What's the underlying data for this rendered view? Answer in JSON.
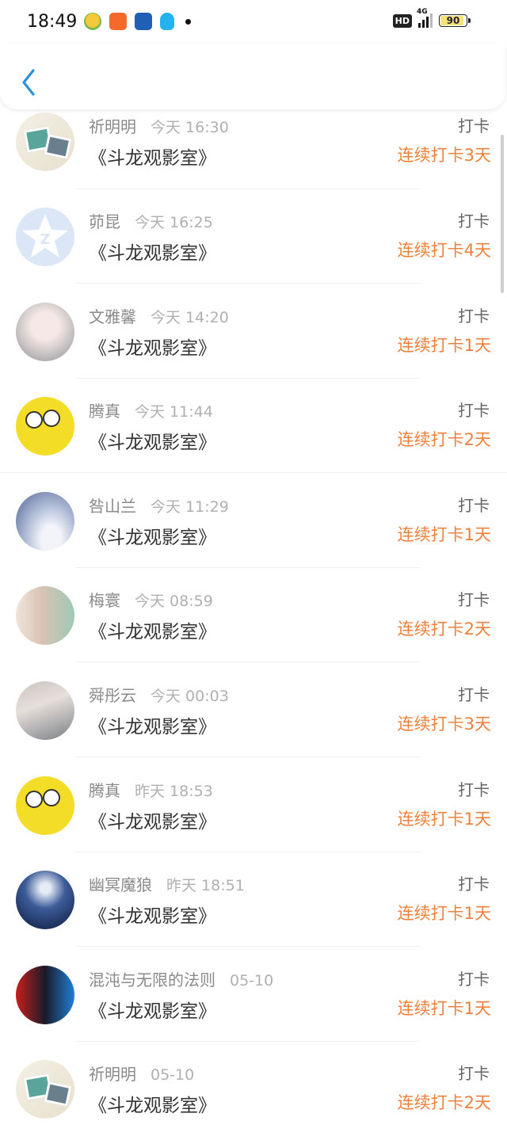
{
  "status_bar": {
    "time": "18:49",
    "hd_label": "HD",
    "network_label": "4G",
    "battery_percent": "90",
    "battery_level": 0.9,
    "notification_icons": [
      "emoji-app-icon",
      "orange-app-icon",
      "blue-app-icon",
      "qq-icon",
      "dot-icon"
    ]
  },
  "header": {
    "back_icon": "chevron-left-icon"
  },
  "colors": {
    "accent": "#f0813c",
    "back_arrow": "#2b8fe0"
  },
  "checkins": [
    {
      "name": "祈明明",
      "when": "今天 16:30",
      "room": "《斗龙观影室》",
      "action": "打卡",
      "streak": "连续打卡3天",
      "avatar": "photos"
    },
    {
      "name": "茆昆",
      "when": "今天 16:25",
      "room": "《斗龙观影室》",
      "action": "打卡",
      "streak": "连续打卡4天",
      "avatar": "qq"
    },
    {
      "name": "文雅馨",
      "when": "今天 14:20",
      "room": "《斗龙观影室》",
      "action": "打卡",
      "streak": "连续打卡1天",
      "avatar": "anime"
    },
    {
      "name": "腾真",
      "when": "今天 11:44",
      "room": "《斗龙观影室》",
      "action": "打卡",
      "streak": "连续打卡2天",
      "avatar": "sponge"
    },
    {
      "name": "咎山兰",
      "when": "今天 11:29",
      "room": "《斗龙观影室》",
      "action": "打卡",
      "streak": "连续打卡1天",
      "avatar": "sky"
    },
    {
      "name": "梅寰",
      "when": "今天 08:59",
      "room": "《斗龙观影室》",
      "action": "打卡",
      "streak": "连续打卡2天",
      "avatar": "girl"
    },
    {
      "name": "舜彤云",
      "when": "今天 00:03",
      "room": "《斗龙观影室》",
      "action": "打卡",
      "streak": "连续打卡3天",
      "avatar": "hair"
    },
    {
      "name": "腾真",
      "when": "昨天 18:53",
      "room": "《斗龙观影室》",
      "action": "打卡",
      "streak": "连续打卡1天",
      "avatar": "sponge"
    },
    {
      "name": "幽冥魔狼",
      "when": "昨天 18:51",
      "room": "《斗龙观影室》",
      "action": "打卡",
      "streak": "连续打卡1天",
      "avatar": "wolf"
    },
    {
      "name": "混沌与无限的法则",
      "when": "05-10",
      "room": "《斗龙观影室》",
      "action": "打卡",
      "streak": "连续打卡1天",
      "avatar": "fire"
    },
    {
      "name": "祈明明",
      "when": "05-10",
      "room": "《斗龙观影室》",
      "action": "打卡",
      "streak": "连续打卡2天",
      "avatar": "photos"
    }
  ]
}
